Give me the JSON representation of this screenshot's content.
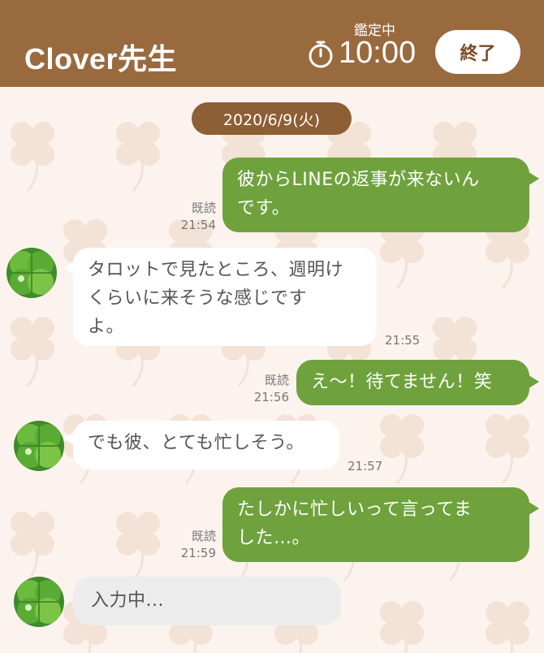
{
  "header": {
    "title": "Clover先生",
    "status_label": "鑑定中",
    "timer": "10:00",
    "end_button": "終了"
  },
  "date": "2020/6/9(火)",
  "messages": [
    {
      "side": "sent",
      "lines": [
        "彼からLINEの返事が来ないん",
        "です。"
      ],
      "read": "既読",
      "time": "21:54"
    },
    {
      "side": "received",
      "lines": [
        "タロットで見たところ、週明け",
        "くらいに来そうな感じです",
        "よ。"
      ],
      "time": "21:55"
    },
    {
      "side": "sent",
      "lines": [
        "え〜！待てません！笑"
      ],
      "read": "既読",
      "time": "21:56"
    },
    {
      "side": "received",
      "lines": [
        "でも彼、とても忙しそう。"
      ],
      "time": "21:57"
    },
    {
      "side": "sent",
      "lines": [
        "たしかに忙しいって言ってま",
        "した…。"
      ],
      "read": "既読",
      "time": "21:59"
    }
  ],
  "typing": "入力中...",
  "icons": {
    "timer": "stopwatch-icon",
    "avatar": "clover-leaf-avatar",
    "background": "clover-pattern"
  },
  "colors": {
    "header": "#9a6a3f",
    "date_pill": "#8e5e34",
    "sent_bubble": "#6fa23d",
    "received_bubble": "#ffffff",
    "typing_bubble": "#ececec",
    "background": "#fcf3ef"
  }
}
